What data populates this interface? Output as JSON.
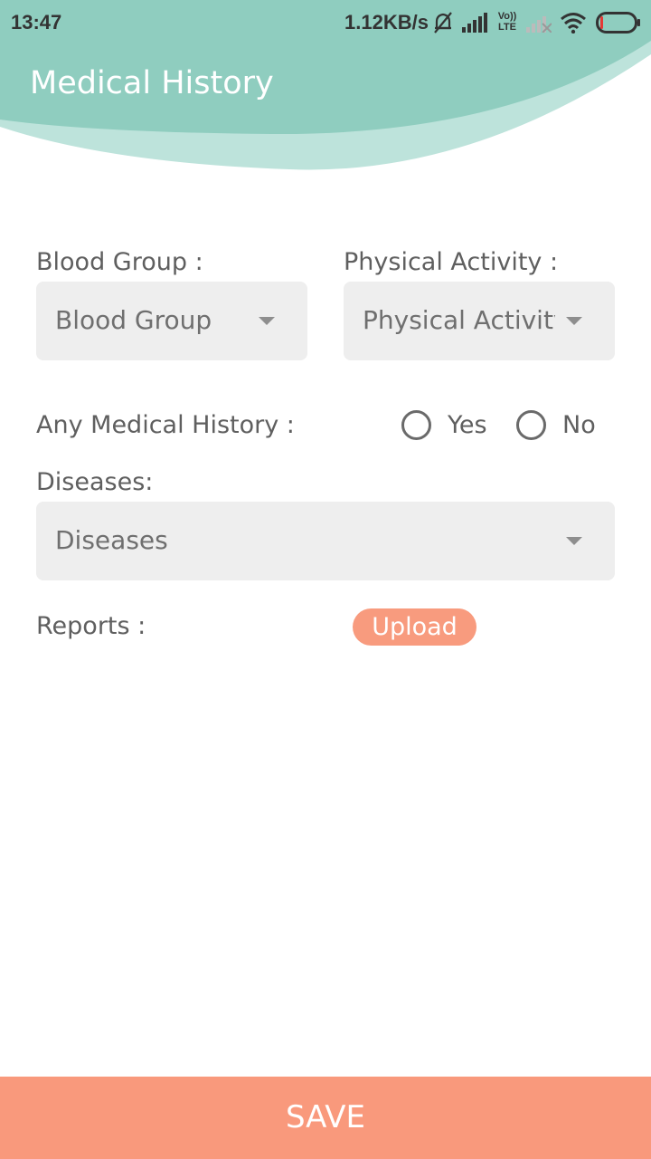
{
  "status_bar": {
    "time": "13:47",
    "network_speed": "1.12KB/s",
    "icons": [
      "mute-bell-icon",
      "signal-icon",
      "volte-lte-icon",
      "signal-weak-icon",
      "wifi-icon",
      "battery-icon"
    ],
    "lte_label_top": "Vo))",
    "lte_label_bottom": "LTE"
  },
  "header": {
    "title": "Medical History",
    "colors": {
      "wave_dark": "#8fcdbf",
      "wave_light": "#bde3db"
    }
  },
  "form": {
    "blood_group": {
      "label": "Blood Group :",
      "value": "Blood Group"
    },
    "physical_activity": {
      "label": "Physical Activity :",
      "value": "Physical Activity"
    },
    "medical_history": {
      "label": "Any Medical History :",
      "options": [
        {
          "label": "Yes",
          "selected": false
        },
        {
          "label": "No",
          "selected": false
        }
      ]
    },
    "diseases": {
      "label": "Diseases:",
      "value": "Diseases"
    },
    "reports": {
      "label": "Reports :",
      "upload_label": "Upload"
    }
  },
  "footer": {
    "save_label": "SAVE",
    "color": "#f9997c"
  }
}
